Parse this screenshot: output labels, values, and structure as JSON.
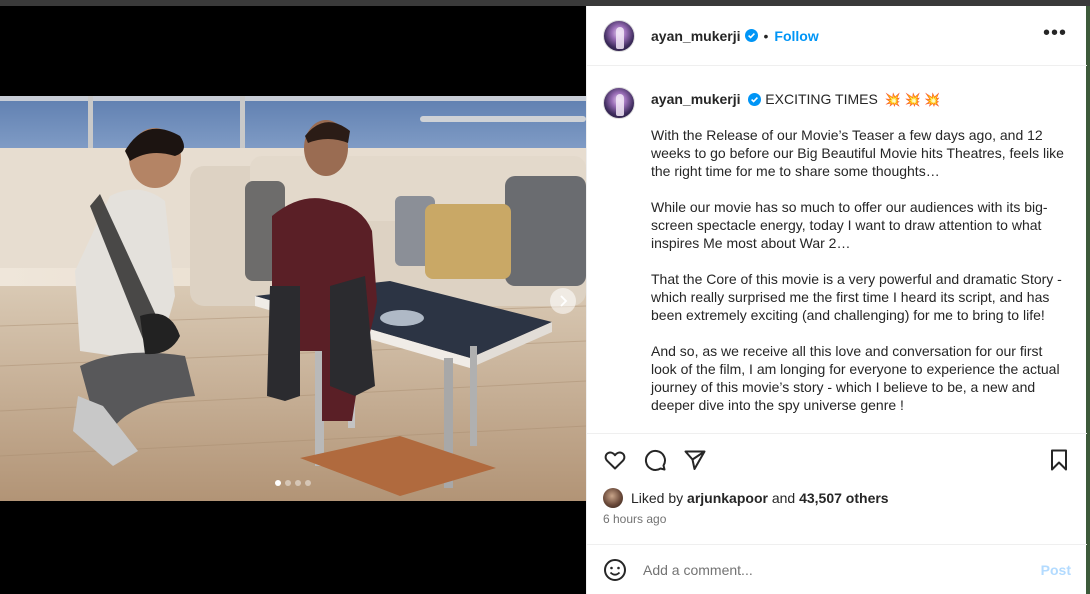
{
  "post": {
    "username": "ayan_mukerji",
    "follow_label": "Follow",
    "more_label": "•••",
    "bullet": "•",
    "caption_head": "EXCITING TIMES",
    "caption_emoji": "💥 💥 💥",
    "caption_paragraphs": [
      "With the Release of our Movie’s Teaser a few days ago, and 12 weeks to go before our Big Beautiful Movie hits Theatres, feels like the right time for me to share some thoughts…",
      "While our movie has so much to offer our audiences with its big-screen spectacle energy, today I want to draw attention to what inspires Me most about War 2…",
      "That the Core of this movie is a very powerful and dramatic Story - which really surprised me the first time I heard its script, and has been extremely exciting (and challenging) for me to bring to life!",
      "And so, as we receive all this love and conversation for our first look of the film, I am longing for everyone to experience the actual journey of this movie’s story - which I believe to be, a new and deeper dive into the spy universe genre !"
    ],
    "likes": {
      "prefix": "Liked by",
      "user": "arjunkapoor",
      "and": "and",
      "others": "43,507 others"
    },
    "time": "6 hours ago",
    "comment": {
      "placeholder": "Add a comment...",
      "value": "",
      "post_label": "Post"
    }
  },
  "media": {
    "carousel_count": 4,
    "active_index": 0
  },
  "icons": {
    "verified": "verified-badge-icon",
    "like": "heart-icon",
    "comment": "comment-bubble-icon",
    "share": "paper-plane-icon",
    "save": "bookmark-icon",
    "emoji": "smiley-icon",
    "next": "chevron-right-icon"
  },
  "colors": {
    "accent": "#0095f6",
    "post_disabled": "#b3dbff",
    "verified": "#0095f6",
    "muted": "#737373"
  }
}
